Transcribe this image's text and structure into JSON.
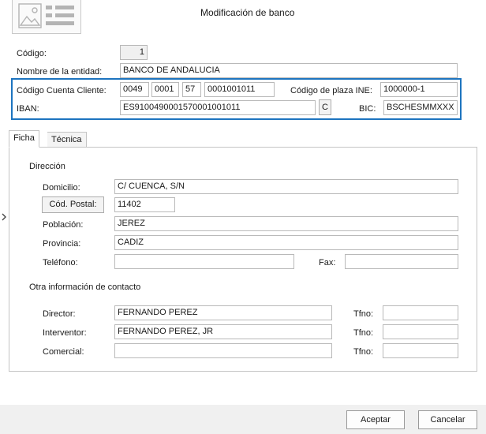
{
  "window": {
    "title": "Modificación de banco"
  },
  "header_fields": {
    "codigo": {
      "label": "Código:",
      "value": "1"
    },
    "entidad": {
      "label": "Nombre de la entidad:",
      "value": "BANCO DE ANDALUCIA"
    }
  },
  "account": {
    "ccc_label": "Código Cuenta Cliente:",
    "ccc_entidad": "0049",
    "ccc_oficina": "0001",
    "ccc_dc": "57",
    "ccc_cuenta": "0001001011",
    "ine_label": "Código de plaza INE:",
    "ine_value": "1000000-1",
    "iban_label": "IBAN:",
    "iban_value": "ES9100490001570001001011",
    "calc_button": "C",
    "bic_label": "BIC:",
    "bic_value": "BSCHESMMXXX"
  },
  "tabs": [
    {
      "label": "Ficha",
      "active": true
    },
    {
      "label": "Técnica",
      "active": false
    }
  ],
  "direccion": {
    "section_title": "Dirección",
    "domicilio_label": "Domicilio:",
    "domicilio_value": "C/ CUENCA, S/N",
    "cp_button": "Cód. Postal:",
    "cp_value": "11402",
    "poblacion_label": "Población:",
    "poblacion_value": "JEREZ",
    "provincia_label": "Provincia:",
    "provincia_value": "CADIZ",
    "telefono_label": "Teléfono:",
    "telefono_value": "",
    "fax_label": "Fax:",
    "fax_value": ""
  },
  "contacto": {
    "section_title": "Otra información de contacto",
    "director_label": "Director:",
    "director_value": "FERNANDO PEREZ",
    "director_tfno_label": "Tfno:",
    "director_tfno_value": "",
    "interventor_label": "Interventor:",
    "interventor_value": "FERNANDO PEREZ, JR",
    "interventor_tfno_label": "Tfno:",
    "interventor_tfno_value": "",
    "comercial_label": "Comercial:",
    "comercial_value": "",
    "comercial_tfno_label": "Tfno:",
    "comercial_tfno_value": ""
  },
  "footer": {
    "accept_label": "Aceptar",
    "cancel_label": "Cancelar"
  },
  "icons": {
    "header_image": "image-card-icon",
    "side_arrow": "chevron-right-icon"
  },
  "colors": {
    "highlight_border": "#1d74bf",
    "footer_bg": "#f0f0f0"
  }
}
